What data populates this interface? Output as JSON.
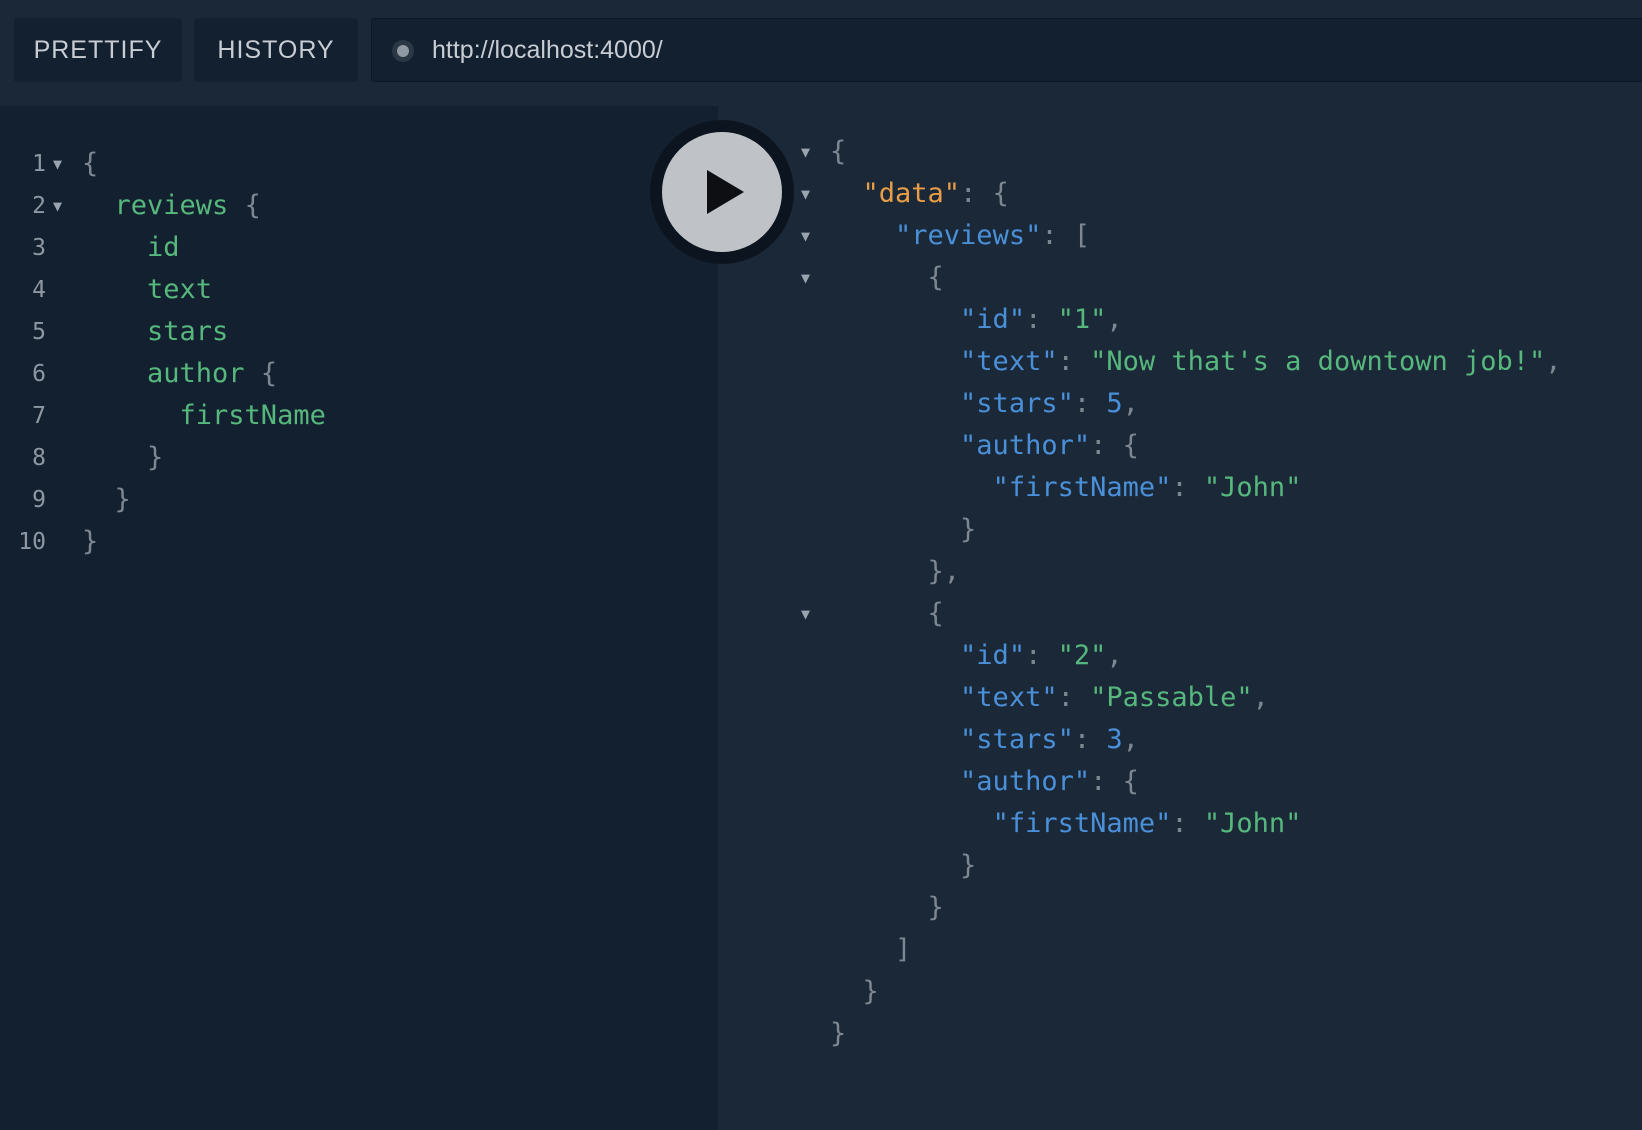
{
  "toolbar": {
    "prettify_label": "PRETTIFY",
    "history_label": "HISTORY",
    "url": "http://localhost:4000/"
  },
  "editor": {
    "lines": [
      {
        "num": "1",
        "fold": "▼",
        "tokens": [
          {
            "text": "{",
            "kind": "punct"
          }
        ]
      },
      {
        "num": "2",
        "fold": "▼",
        "tokens": [
          {
            "text": "  reviews",
            "kind": "field"
          },
          {
            "text": " {",
            "kind": "punct"
          }
        ]
      },
      {
        "num": "3",
        "fold": "",
        "tokens": [
          {
            "text": "    id",
            "kind": "field"
          }
        ]
      },
      {
        "num": "4",
        "fold": "",
        "tokens": [
          {
            "text": "    text",
            "kind": "field"
          }
        ]
      },
      {
        "num": "5",
        "fold": "",
        "tokens": [
          {
            "text": "    stars",
            "kind": "field"
          }
        ]
      },
      {
        "num": "6",
        "fold": "",
        "tokens": [
          {
            "text": "    author",
            "kind": "field"
          },
          {
            "text": " {",
            "kind": "punct"
          }
        ]
      },
      {
        "num": "7",
        "fold": "",
        "tokens": [
          {
            "text": "      firstName",
            "kind": "field"
          }
        ]
      },
      {
        "num": "8",
        "fold": "",
        "tokens": [
          {
            "text": "    }",
            "kind": "punct"
          }
        ]
      },
      {
        "num": "9",
        "fold": "",
        "tokens": [
          {
            "text": "  }",
            "kind": "punct"
          }
        ]
      },
      {
        "num": "10",
        "fold": "",
        "tokens": [
          {
            "text": "}",
            "kind": "punct"
          }
        ]
      }
    ]
  },
  "run_button": {
    "icon": "play-icon"
  },
  "result": {
    "lines": [
      {
        "fold": "▼",
        "tokens": [
          {
            "text": "{",
            "kind": "punct"
          }
        ]
      },
      {
        "fold": "▼",
        "tokens": [
          {
            "text": "  ",
            "kind": "punct"
          },
          {
            "text": "\"data\"",
            "kind": "key-orange"
          },
          {
            "text": ": {",
            "kind": "punct"
          }
        ]
      },
      {
        "fold": "▼",
        "tokens": [
          {
            "text": "    ",
            "kind": "punct"
          },
          {
            "text": "\"reviews\"",
            "kind": "key-blue"
          },
          {
            "text": ": [",
            "kind": "punct"
          }
        ]
      },
      {
        "fold": "▼",
        "tokens": [
          {
            "text": "      {",
            "kind": "punct"
          }
        ]
      },
      {
        "fold": "",
        "tokens": [
          {
            "text": "        ",
            "kind": "punct"
          },
          {
            "text": "\"id\"",
            "kind": "key-blue"
          },
          {
            "text": ": ",
            "kind": "punct"
          },
          {
            "text": "\"1\"",
            "kind": "str"
          },
          {
            "text": ",",
            "kind": "punct"
          }
        ]
      },
      {
        "fold": "",
        "tokens": [
          {
            "text": "        ",
            "kind": "punct"
          },
          {
            "text": "\"text\"",
            "kind": "key-blue"
          },
          {
            "text": ": ",
            "kind": "punct"
          },
          {
            "text": "\"Now that's a downtown job!\"",
            "kind": "str"
          },
          {
            "text": ",",
            "kind": "punct"
          }
        ]
      },
      {
        "fold": "",
        "tokens": [
          {
            "text": "        ",
            "kind": "punct"
          },
          {
            "text": "\"stars\"",
            "kind": "key-blue"
          },
          {
            "text": ": ",
            "kind": "punct"
          },
          {
            "text": "5",
            "kind": "num"
          },
          {
            "text": ",",
            "kind": "punct"
          }
        ]
      },
      {
        "fold": "",
        "tokens": [
          {
            "text": "        ",
            "kind": "punct"
          },
          {
            "text": "\"author\"",
            "kind": "key-blue"
          },
          {
            "text": ": {",
            "kind": "punct"
          }
        ]
      },
      {
        "fold": "",
        "tokens": [
          {
            "text": "          ",
            "kind": "punct"
          },
          {
            "text": "\"firstName\"",
            "kind": "key-blue"
          },
          {
            "text": ": ",
            "kind": "punct"
          },
          {
            "text": "\"John\"",
            "kind": "str"
          }
        ]
      },
      {
        "fold": "",
        "tokens": [
          {
            "text": "        }",
            "kind": "punct"
          }
        ]
      },
      {
        "fold": "",
        "tokens": [
          {
            "text": "      },",
            "kind": "punct"
          }
        ]
      },
      {
        "fold": "▼",
        "tokens": [
          {
            "text": "      {",
            "kind": "punct"
          }
        ]
      },
      {
        "fold": "",
        "tokens": [
          {
            "text": "        ",
            "kind": "punct"
          },
          {
            "text": "\"id\"",
            "kind": "key-blue"
          },
          {
            "text": ": ",
            "kind": "punct"
          },
          {
            "text": "\"2\"",
            "kind": "str"
          },
          {
            "text": ",",
            "kind": "punct"
          }
        ]
      },
      {
        "fold": "",
        "tokens": [
          {
            "text": "        ",
            "kind": "punct"
          },
          {
            "text": "\"text\"",
            "kind": "key-blue"
          },
          {
            "text": ": ",
            "kind": "punct"
          },
          {
            "text": "\"Passable\"",
            "kind": "str"
          },
          {
            "text": ",",
            "kind": "punct"
          }
        ]
      },
      {
        "fold": "",
        "tokens": [
          {
            "text": "        ",
            "kind": "punct"
          },
          {
            "text": "\"stars\"",
            "kind": "key-blue"
          },
          {
            "text": ": ",
            "kind": "punct"
          },
          {
            "text": "3",
            "kind": "num"
          },
          {
            "text": ",",
            "kind": "punct"
          }
        ]
      },
      {
        "fold": "",
        "tokens": [
          {
            "text": "        ",
            "kind": "punct"
          },
          {
            "text": "\"author\"",
            "kind": "key-blue"
          },
          {
            "text": ": {",
            "kind": "punct"
          }
        ]
      },
      {
        "fold": "",
        "tokens": [
          {
            "text": "          ",
            "kind": "punct"
          },
          {
            "text": "\"firstName\"",
            "kind": "key-blue"
          },
          {
            "text": ": ",
            "kind": "punct"
          },
          {
            "text": "\"John\"",
            "kind": "str"
          }
        ]
      },
      {
        "fold": "",
        "tokens": [
          {
            "text": "        }",
            "kind": "punct"
          }
        ]
      },
      {
        "fold": "",
        "tokens": [
          {
            "text": "      }",
            "kind": "punct"
          }
        ]
      },
      {
        "fold": "",
        "tokens": [
          {
            "text": "    ]",
            "kind": "punct"
          }
        ]
      },
      {
        "fold": "",
        "tokens": [
          {
            "text": "  }",
            "kind": "punct"
          }
        ]
      },
      {
        "fold": "",
        "tokens": [
          {
            "text": "}",
            "kind": "punct"
          }
        ]
      }
    ]
  }
}
